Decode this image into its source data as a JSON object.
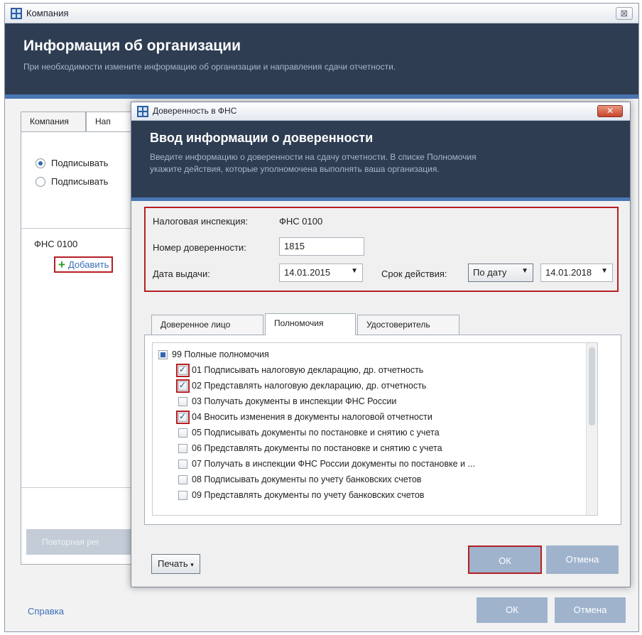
{
  "outer": {
    "title": "Компания",
    "close": "⊠",
    "header_title": "Информация об организации",
    "header_subtitle": "При необходимости измените информацию об организации и направления сдачи отчетности.",
    "tabs": [
      "Компания",
      "Нап"
    ],
    "radios": [
      {
        "label": "Подписывать",
        "selected": true
      },
      {
        "label": "Подписывать",
        "selected": false
      }
    ],
    "fns_label": "ФНС 0100",
    "add_label": "Добавить",
    "repeat_button": "Повторная рег",
    "help": "Справка",
    "ok": "ОК",
    "cancel": "Отмена"
  },
  "dialog": {
    "title": "Доверенность в ФНС",
    "close": "✕",
    "header_title": "Ввод информации о доверенности",
    "header_line1": "Введите информацию о доверенности на сдачу отчетности. В списке Полномочия",
    "header_line2": "укажите действия, которые уполномочена выполнять ваша организация.",
    "tax_office_label": "Налоговая инспекция:",
    "tax_office_value": "ФНС 0100",
    "proxy_number_label": "Номер доверенности:",
    "proxy_number_value": "1815",
    "issue_date_label": "Дата выдачи:",
    "issue_date_value": "14.01.2015",
    "validity_label": "Срок действия:",
    "validity_mode": "По дату",
    "validity_date": "14.01.2018",
    "tabs": [
      "Доверенное лицо",
      "Полномочия",
      "Удостоверитель"
    ],
    "active_tab": "Полномочия",
    "permissions": [
      {
        "label": "99 Полные полномочия",
        "state": "partial",
        "level": 0
      },
      {
        "label": "01 Подписывать налоговую декларацию, др. отчетность",
        "state": "checked",
        "level": 1
      },
      {
        "label": "02 Представлять налоговую декларацию, др. отчетность",
        "state": "checked",
        "level": 1
      },
      {
        "label": "03 Получать документы в инспекции ФНС России",
        "state": "unchecked",
        "level": 1
      },
      {
        "label": "04 Вносить изменения в документы налоговой отчетности",
        "state": "checked",
        "level": 1
      },
      {
        "label": "05 Подписывать документы по постановке и снятию с учета",
        "state": "unchecked",
        "level": 1
      },
      {
        "label": "06 Представлять документы по постановке и снятию с учета",
        "state": "unchecked",
        "level": 1
      },
      {
        "label": "07 Получать в инспекции ФНС России документы по постановке и ...",
        "state": "unchecked",
        "level": 1
      },
      {
        "label": "08 Подписывать документы по учету банковских счетов",
        "state": "unchecked",
        "level": 1
      },
      {
        "label": "09 Представлять документы по учету банковских счетов",
        "state": "unchecked",
        "level": 1
      }
    ],
    "print_button": "Печать",
    "ok": "ОК",
    "cancel": "Отмена"
  },
  "colors": {
    "header_bg": "#2e3d52",
    "accent": "#4a77b4",
    "highlight": "#b41f24",
    "link": "#3b6fb6",
    "flat_button": "#9fb3cd"
  }
}
